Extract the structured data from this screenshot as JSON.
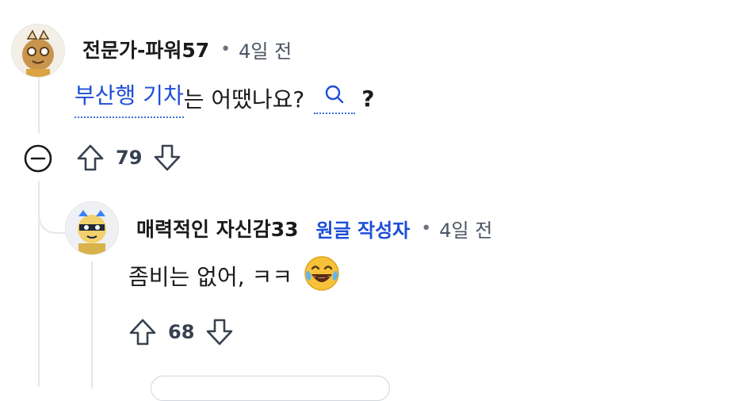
{
  "comment1": {
    "username": "전문가-파워57",
    "separator": "•",
    "time": "4일 전",
    "link_text": "부산행 기차",
    "text_after": "는 어땠나요?",
    "suffix": "?",
    "score": "79"
  },
  "comment2": {
    "username": "매력적인 자신감33",
    "op_badge": "원글 작성자",
    "separator": "•",
    "time": "4일 전",
    "text": "좀비는 없어, ㅋㅋ",
    "score": "68"
  },
  "icons": {
    "collapse": "collapse-minus-icon",
    "upvote": "upvote-arrow-icon",
    "downvote": "downvote-arrow-icon",
    "search": "search-icon",
    "emoji": "laughing-tears-emoji"
  },
  "colors": {
    "link": "#1d4ed8",
    "thread_line": "#e5e7eb",
    "text": "#1a1a1b"
  }
}
